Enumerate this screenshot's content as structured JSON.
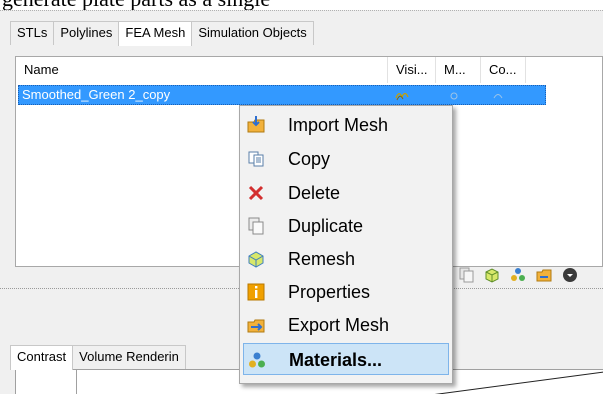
{
  "caption": "generate plate parts as a single",
  "top_tabs": [
    "STLs",
    "Polylines",
    "FEA Mesh",
    "Simulation Objects"
  ],
  "top_active_tab": "FEA Mesh",
  "columns": [
    "Name",
    "Visi...",
    "M...",
    "Co..."
  ],
  "row": {
    "name": "Smoothed_Green 2_copy"
  },
  "context_menu": [
    {
      "label": "Import Mesh",
      "icon": "import-mesh-icon"
    },
    {
      "label": "Copy",
      "icon": "copy-icon"
    },
    {
      "label": "Delete",
      "icon": "delete-icon"
    },
    {
      "label": "Duplicate",
      "icon": "duplicate-icon"
    },
    {
      "label": "Remesh",
      "icon": "remesh-icon"
    },
    {
      "label": "Properties",
      "icon": "properties-icon"
    },
    {
      "label": "Export Mesh",
      "icon": "export-mesh-icon"
    },
    {
      "label": "Materials...",
      "icon": "materials-icon"
    }
  ],
  "highlighted_menu_item": "Materials...",
  "bottom_tabs": [
    "Contrast",
    "Volume Renderin"
  ],
  "bottom_active_tab": "Contrast",
  "colors": {
    "selection": "#3399ff",
    "menu_highlight": "#cce4f7",
    "delete_red": "#d32f2f",
    "properties_orange": "#f0a000"
  }
}
